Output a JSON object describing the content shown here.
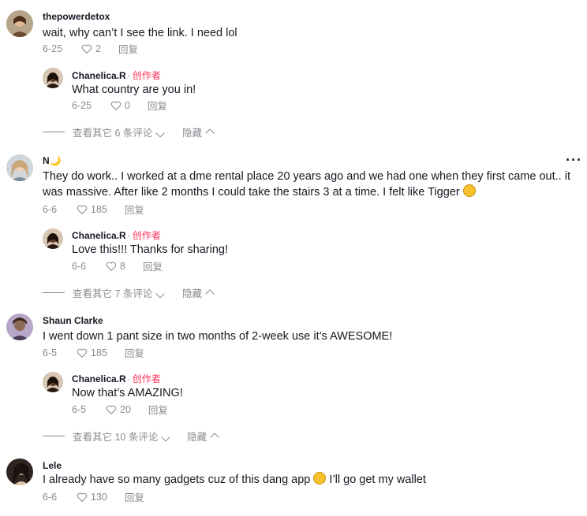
{
  "comments": [
    {
      "username": "thepowerdetox",
      "text": "wait, why can’t I see the link. I need lol",
      "date": "6-25",
      "likes": "2",
      "reply_label": "回复",
      "reply": {
        "username": "Chanelica.R",
        "creator_label": "创作者",
        "text": "What country are you in!",
        "date": "6-25",
        "likes": "0",
        "reply_label": "回复"
      },
      "view_more": "查看其它 6 条评论",
      "hide_label": "隐藏"
    },
    {
      "username": "N🌙",
      "text": "They do work.. I worked at a dme rental place 20 years ago and we had one when they first came out.. it was massive. After like 2 months I could take the stairs 3 at a time. I felt like Tigger",
      "date": "6-6",
      "likes": "185",
      "reply_label": "回复",
      "reply": {
        "username": "Chanelica.R",
        "creator_label": "创作者",
        "text": "Love this!!! Thanks for sharing!",
        "date": "6-6",
        "likes": "8",
        "reply_label": "回复"
      },
      "view_more": "查看其它 7 条评论",
      "hide_label": "隐藏"
    },
    {
      "username": "Shaun Clarke",
      "text": "I went down 1 pant size in two months of 2-week use it’s AWESOME!",
      "date": "6-5",
      "likes": "185",
      "reply_label": "回复",
      "reply": {
        "username": "Chanelica.R",
        "creator_label": "创作者",
        "text": "Now that’s AMAZING!",
        "date": "6-5",
        "likes": "20",
        "reply_label": "回复"
      },
      "view_more": "查看其它 10 条评论",
      "hide_label": "隐藏"
    },
    {
      "username": "Lele",
      "text": "I already have so many gadgets cuz of this dang app",
      "text_after_emoji": "I’ll go get my wallet",
      "date": "6-6",
      "likes": "130",
      "reply_label": "回复"
    }
  ],
  "more_label": "···",
  "colors": {
    "creator": "#fe2c55",
    "muted": "#8a8b91",
    "text": "#161823"
  },
  "icons": {
    "like": "heart-outline-icon",
    "expand": "chevron-down-icon",
    "collapse": "chevron-up-icon",
    "more": "more-options-icon"
  }
}
